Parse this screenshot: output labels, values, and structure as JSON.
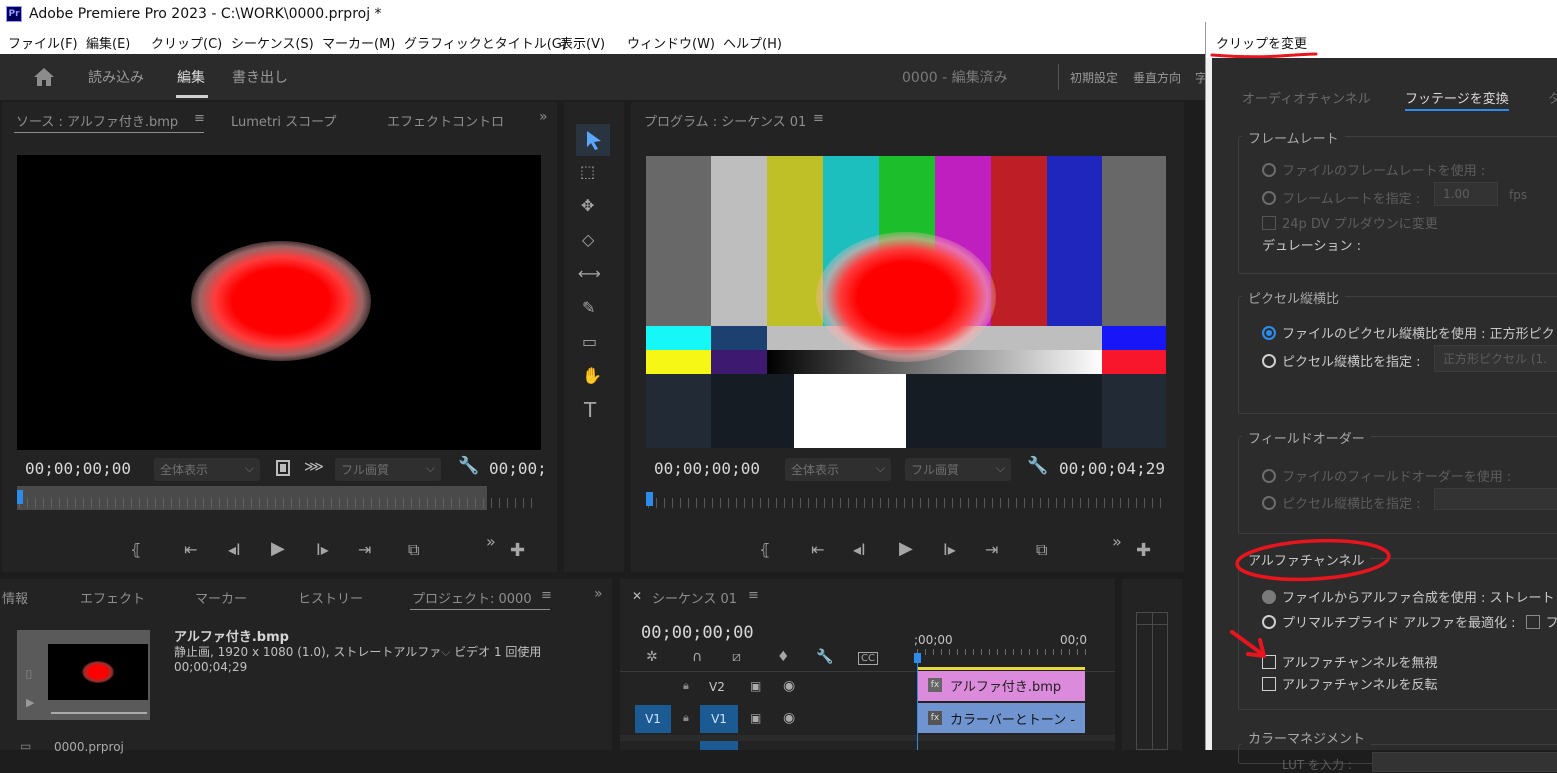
{
  "window": {
    "title": "Adobe Premiere Pro 2023 - C:\\WORK\\0000.prproj *",
    "app_icon": "Pr"
  },
  "menu": [
    "ファイル(F)",
    "編集(E)",
    "クリップ(C)",
    "シーケンス(S)",
    "マーカー(M)",
    "グラフィックとタイトル(G)",
    "表示(V)",
    "ウィンドウ(W)",
    "ヘルプ(H)"
  ],
  "workspace": {
    "tabs": [
      "読み込み",
      "編集",
      "書き出し"
    ],
    "project_status": "0000 - 編集済み",
    "right": [
      "初期設定",
      "垂直方向",
      "字"
    ]
  },
  "source": {
    "tabs": [
      "ソース : アルファ付き.bmp",
      "Lumetri スコープ",
      "エフェクトコントロ"
    ],
    "timecode_left": "00;00;00;00",
    "fit": "全体表示",
    "quality": "フル画質",
    "timecode_right": "00;00;"
  },
  "program": {
    "title": "プログラム : シーケンス 01",
    "timecode_left": "00;00;00;00",
    "fit": "全体表示",
    "quality": "フル画質",
    "timecode_right": "00;00;04;29"
  },
  "project": {
    "tabs": [
      "情報",
      "エフェクト",
      "マーカー",
      "ヒストリー",
      "プロジェクト: 0000"
    ],
    "clip_name": "アルファ付き.bmp",
    "clip_info": "静止画, 1920 x 1080 (1.0), ストレートアルファ",
    "video_usage": "ビデオ 1 回使用",
    "duration": "00;00;04;29",
    "project_file": "0000.prproj"
  },
  "timeline": {
    "tab": "シーケンス 01",
    "timecode": "00;00;00;00",
    "ruler_start": ";00;00",
    "ruler_next": "00;0",
    "tracks": [
      {
        "target": "",
        "name": "V2",
        "clip": "アルファ付き.bmp",
        "color": "#dc8bdc"
      },
      {
        "target": "V1",
        "name": "V1",
        "clip": "カラーバーとトーン -",
        "color": "#6f94cf"
      }
    ],
    "fx": "fx"
  },
  "dialog": {
    "title": "クリップを変更",
    "tabs": [
      "オーディオチャンネル",
      "フッテージを変換",
      "タ"
    ],
    "framerate": {
      "title": "フレームレート",
      "use_file": "ファイルのフレームレートを使用 :",
      "assume": "フレームレートを指定 :",
      "assume_value": "1.00",
      "unit": "fps",
      "pulldown": "24p DV プルダウンに変更",
      "duration_label": "デュレーション :"
    },
    "pixel": {
      "title": "ピクセル縦横比",
      "use_file": "ファイルのピクセル縦横比を使用 :",
      "use_file_value": "正方形ピク",
      "conform": "ピクセル縦横比を指定 :",
      "conform_value": "正方形ピクセル (1."
    },
    "field": {
      "title": "フィールドオーダー",
      "use_file": "ファイルのフィールドオーダーを使用 :",
      "conform": "ピクセル縦横比を指定 :"
    },
    "alpha": {
      "title": "アルファチャンネル",
      "use_file": "ファイルからアルファ合成を使用 :",
      "use_file_value": "ストレート",
      "premult": "プリマルチプライド アルファを最適化 :",
      "premult_check": "フ",
      "ignore": "アルファチャンネルを無視",
      "invert": "アルファチャンネルを反転"
    },
    "color": {
      "title": "カラーマネジメント",
      "lut": "LUT を入力 :"
    }
  },
  "colors": {
    "annotation": "#e8141e",
    "accent": "#2d8ceb",
    "playhead": "#2d8ceb"
  }
}
